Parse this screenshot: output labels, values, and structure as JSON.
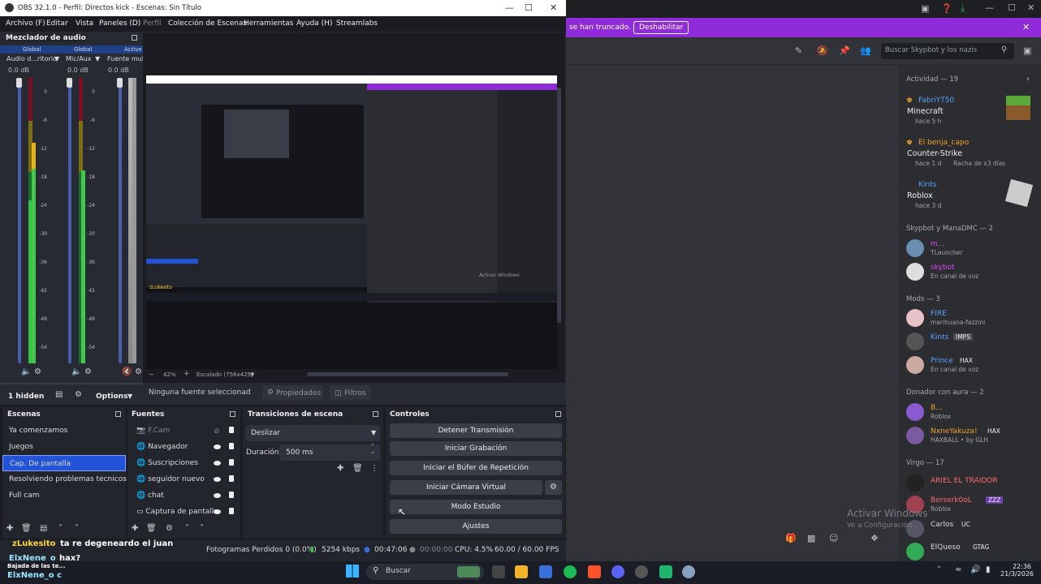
{
  "obs": {
    "title": "OBS 32.1.0 - Perfil: Directos kick - Escenas: Sin Título",
    "menu": [
      "Archivo (F)",
      "Editar",
      "Vista",
      "Paneles (D)",
      "Perfil",
      "Colección de Escenas",
      "Herramientas",
      "Ayuda (H)",
      "Streamlabs"
    ],
    "mixer": {
      "title": "Mezclador de audio",
      "labels": [
        "Global",
        "Global",
        "Active"
      ],
      "channels": [
        {
          "name": "Audio d...ritorio",
          "db": "0.0 dB"
        },
        {
          "name": "Mic/Aux",
          "db": "0.0 dB"
        },
        {
          "name": "Fuente mul",
          "db": "0.0 dB"
        }
      ],
      "scale": [
        "0",
        "-6",
        "-12",
        "-18",
        "-24",
        "-30",
        "-36",
        "-42",
        "-48",
        "-54",
        "-60"
      ],
      "hidden": "1 hidden",
      "options": "Options"
    },
    "preview": {
      "zoom": "42%",
      "scale": "Escalado (756x425)"
    },
    "source_bar": {
      "none": "Ninguna fuente seleccionad",
      "props": "Propiedades",
      "filters": "Filtros"
    },
    "scenes": {
      "title": "Escenas",
      "items": [
        "Ya comenzamos",
        "Juegos",
        "Cap. De pantalla",
        "Resolviendo problemas tecnicos",
        "Full cam"
      ],
      "selected": 2
    },
    "sources": {
      "title": "Fuentes",
      "items": [
        "F.Cam",
        "Navegador",
        "Suscripciones",
        "seguidor nuevo",
        "chat",
        "Captura de pantalla"
      ]
    },
    "transitions": {
      "title": "Transiciones de escena",
      "type": "Deslizar",
      "duration_label": "Duración",
      "duration": "500 ms"
    },
    "controls": {
      "title": "Controles",
      "buttons": [
        "Detener Transmisión",
        "Iniciar Grabación",
        "Iniciar el Búfer de Repetición",
        "Iniciar Cámara Virtual",
        "Modo Estudio",
        "Ajustes"
      ]
    },
    "status": {
      "dropped": "Fotogramas Perdidos 0 (0.0%)",
      "kbps": "5254 kbps",
      "stream": "00:47:06",
      "rec": "00:00:00",
      "cpu": "CPU: 4.5%",
      "fps": "60.00 / 60.00 FPS"
    },
    "overlay": {
      "chat1_user": "zLukesito",
      "chat1_msg": "ta re degeneardo el juan",
      "chat2_user": "ElxNene_o",
      "chat2_msg": "hax?",
      "chat3": "Bajada de las te...",
      "chat4": "ElxNene_o c"
    }
  },
  "discord": {
    "banner_text": "se han truncado.",
    "banner_btn": "Deshabilitar",
    "search_placeholder": "Buscar Skypbot y los nazis",
    "activity_title": "Actividad — 19",
    "activities": [
      {
        "name": "FabriYT50",
        "game": "Minecraft",
        "time": "hace 5 h",
        "streak": ""
      },
      {
        "name": "El benja_capo",
        "game": "Counter-Strike",
        "time": "hace 1 d",
        "streak": "Racha de x3 días"
      },
      {
        "name": "Kints",
        "game": "Roblox",
        "time": "hace 3 d",
        "streak": ""
      }
    ],
    "sections": [
      {
        "title": "Skypbot y ManaDMC — 2",
        "members": [
          {
            "name": "m...",
            "status": "TLauncher",
            "color": "#d946ef"
          },
          {
            "name": "skybot",
            "status": "En canal de voz",
            "color": "#d946ef"
          }
        ]
      },
      {
        "title": "Mods — 3",
        "members": [
          {
            "name": "FIRE",
            "status": "marihuana-fazzini",
            "color": "#5aa2ff"
          },
          {
            "name": "Kints",
            "status": "",
            "color": "#5aa2ff",
            "tag": "IMPS"
          },
          {
            "name": "Prince",
            "status": "En canal de voz",
            "color": "#5aa2ff",
            "tag": "HAX"
          }
        ]
      },
      {
        "title": "Donador con aura — 2",
        "members": [
          {
            "name": "B...",
            "status": "Roblox",
            "color": "#f0a030"
          },
          {
            "name": "NxneYakuza!",
            "status": "HAXBALL • by GLH",
            "color": "#f0a030",
            "tag": "HAX"
          }
        ]
      },
      {
        "title": "Virgo — 17",
        "members": [
          {
            "name": "ARIEL EL TRAIDOR",
            "status": "",
            "color": "#ff6b6b"
          },
          {
            "name": "Berserk0oL",
            "status": "Roblox",
            "color": "#ff6b6b",
            "tag": "ZZZ"
          },
          {
            "name": "Carlos",
            "status": "",
            "color": "#eee",
            "tag": "UC"
          },
          {
            "name": "ElQueso",
            "status": "",
            "color": "#eee",
            "tag": "GTAG"
          }
        ]
      }
    ],
    "watermark_title": "Activar Windows",
    "watermark_sub": "Ve a Configuración..."
  },
  "taskbar": {
    "search": "Buscar",
    "time": "22:36",
    "date": "21/3/2026"
  }
}
